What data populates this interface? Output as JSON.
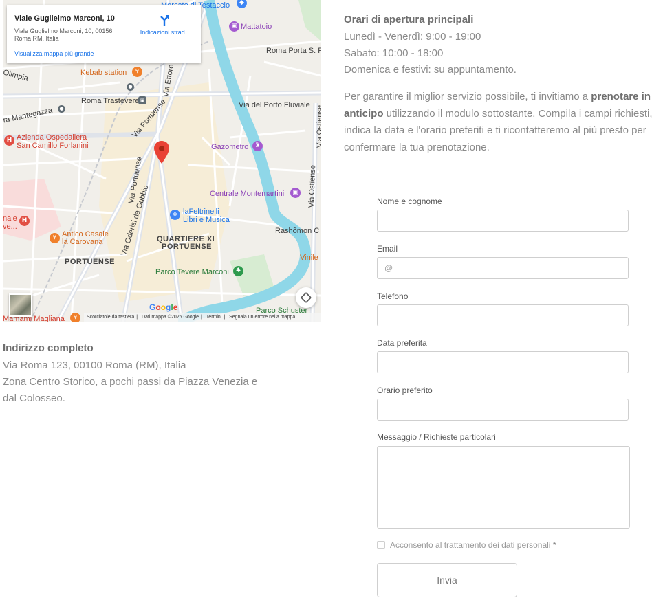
{
  "map": {
    "card": {
      "title": "Viale Guglielmo Marconi, 10",
      "address_line1": "Viale Guglielmo Marconi, 10, 00156",
      "address_line2": "Roma RM, Italia",
      "directions_label": "Indicazioni strad...",
      "larger_map_link": "Visualizza mappa più grande"
    },
    "labels": {
      "mercato": "Mercato di Testaccio",
      "mattatoio": "Mattatoio",
      "roma_porta": "Roma Porta S. Pa",
      "kebab": "Kebab station",
      "roma_trastevere": "Roma Trastevere",
      "via_porto_fluviale": "Via del Porto Fluviale",
      "via_mantegazza": "ra Mantegazza",
      "azienda": "Azienda Ospedaliera",
      "san_camillo": "San Camillo Forlanini",
      "gazometro": "Gazometro",
      "centrale": "Centrale Montemartini",
      "lafeltrinelli": "laFeltrinelli",
      "libri_musica": "Libri e Musica",
      "rashomon": "Rashõmon Cl",
      "quartiere1": "QUARTIERE XI",
      "quartiere2": "PORTUENSE",
      "antico_casale": "Antico Casale",
      "la_carovana": "la Carovana",
      "portuense": "PORTUENSE",
      "vinile": "Vinile",
      "parco_tevere": "Parco Tevere Marconi",
      "parco_schuster": "Parco Schuster",
      "mamami": "Mamami Magliana",
      "nale": "nale",
      "ve": "ve...",
      "olimpia": "Olimpia",
      "via_ettore": "Via Ettore",
      "via_portuense": "Via Portuense",
      "via_portuense2": "Via Portuense",
      "via_oderisi": "Via Oderisi da Gubbio",
      "via_ostiense": "Via Ostiense",
      "via_ostiense2": "Via Ostiense"
    },
    "google_logo": [
      "G",
      "o",
      "o",
      "g",
      "l",
      "e"
    ],
    "footer": {
      "shortcuts": "Scorciatoie da tastiera",
      "data": "Dati mappa ©2026 Google",
      "terms": "Termini",
      "report": "Segnala un errore nella mappa"
    }
  },
  "hours": {
    "title": "Orari di apertura principali",
    "lines": [
      "Lunedì - Venerdì: 9:00 - 19:00",
      "Sabato: 10:00 - 18:00",
      "Domenica e festivi: su appuntamento."
    ]
  },
  "intro": {
    "part1": "Per garantire il miglior servizio possibile, ti invitiamo a ",
    "bold": "prenotare in anticipo",
    "part2": " utilizzando il modulo sottostante. Compila i campi richiesti, indica la data e l'orario preferiti e ti ricontatteremo al più presto per confermare la tua prenotazione."
  },
  "address": {
    "title": "Indirizzo completo",
    "lines": [
      "Via Roma 123, 00100 Roma (RM), Italia",
      "Zona Centro Storico, a pochi passi da Piazza Venezia e",
      "dal Colosseo."
    ]
  },
  "form": {
    "name_label": "Nome e cognome",
    "email_label": "Email",
    "email_placeholder": "@",
    "phone_label": "Telefono",
    "date_label": "Data preferita",
    "time_label": "Orario preferito",
    "message_label": "Messaggio / Richieste particolari",
    "consent_label": "Acconsento al trattamento dei dati personali",
    "consent_required": "*",
    "submit_label": "Invia"
  }
}
